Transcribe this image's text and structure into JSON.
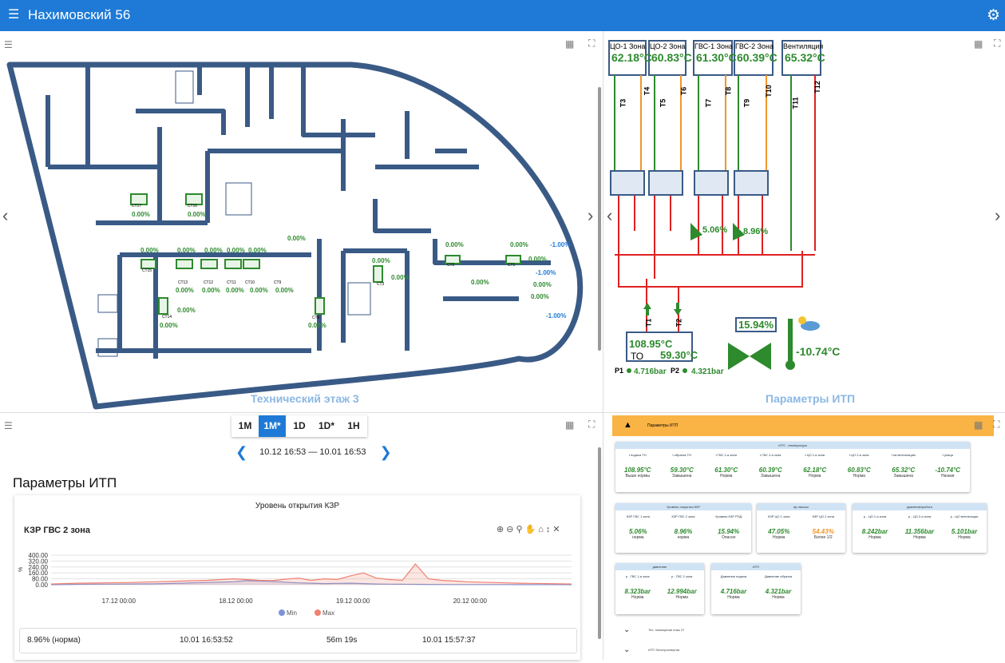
{
  "app": {
    "title": "Нахимовский 56"
  },
  "floor_panel": {
    "title": "Технический этаж 3",
    "devices": [
      {
        "name": "СТ17",
        "value": "0.00%"
      },
      {
        "name": "СТ16",
        "value": "0.00%"
      },
      {
        "name": "СТ15",
        "value": "0.00%"
      },
      {
        "name": "СТ13",
        "value": "0.00%"
      },
      {
        "name": "СТ12",
        "value": "0.00%"
      },
      {
        "name": "СТ11",
        "value": "0.00%"
      },
      {
        "name": "СТ10",
        "value": "0.00%"
      },
      {
        "name": "СТ9",
        "value": "0.00%"
      },
      {
        "name": "СТ14",
        "value": "0.00%"
      },
      {
        "name": "СТ9",
        "value": "0.00%"
      },
      {
        "name": "СТ3",
        "value": "0.00%"
      },
      {
        "name": "СТ2",
        "value": "0.00%"
      },
      {
        "name": "СТ1",
        "value": "0.00%"
      }
    ],
    "extra_values": [
      "0.00%",
      "0.00%",
      "0.00%",
      "0.00%",
      "0.00%",
      "0.00%",
      "0.00%",
      "0.00%",
      "0.00%",
      "0.00%",
      "0.00%",
      "0.00%",
      "-1.00%",
      "-1.00%",
      "-1.00%",
      "0.00%",
      "0.00%",
      "0.00%"
    ]
  },
  "itp_panel": {
    "title": "Параметры ИТП",
    "zones": [
      {
        "label": "ЦО-1 Зона",
        "value": "62.18°C"
      },
      {
        "label": "ЦО-2 Зона",
        "value": "60.83°C"
      },
      {
        "label": "ГВС-1 Зона",
        "value": "61.30°C"
      },
      {
        "label": "ГВС-2 Зона",
        "value": "60.39°C"
      },
      {
        "label": "Вентиляция",
        "value": "65.32°C"
      }
    ],
    "pipes": [
      "T3",
      "T4",
      "T5",
      "T6",
      "T7",
      "T8",
      "T9",
      "T10",
      "T11",
      "T12",
      "T1",
      "T2"
    ],
    "valve1": "5.06%",
    "valve2": "8.96%",
    "to_label": "ТО",
    "to_t1": "108.95°C",
    "to_t2": "59.30°C",
    "p1_label": "P1",
    "p1": "4.716bar",
    "p2_label": "P2",
    "p2": "4.321bar",
    "main_valve": "15.94%",
    "outdoor": "-10.74°C"
  },
  "history": {
    "periods": [
      "1M",
      "1M*",
      "1D",
      "1D*",
      "1H"
    ],
    "active_period": "1M*",
    "range": "10.12 16:53 — 10.01 16:53",
    "section_title": "Параметры ИТП",
    "card_title": "Уровень открытия КЗР",
    "chart_name": "КЗР ГВС 2 зона",
    "stat_value": "8.96% (норма)",
    "stat_time1": "10.01 16:53:52",
    "stat_duration": "56m 19s",
    "stat_time2": "10.01 15:57:37"
  },
  "chart_data": {
    "type": "line",
    "title": "КЗР ГВС 2 зона",
    "ylabel": "%",
    "ylim": [
      0,
      400
    ],
    "yticks": [
      "0.00",
      "80.00",
      "160.00",
      "240.00",
      "320.00",
      "400.00"
    ],
    "xticks": [
      "17.12 00:00",
      "18.12 00:00",
      "19.12 00:00",
      "20.12 00:00"
    ],
    "x": [
      0,
      2,
      4,
      6,
      8,
      10,
      12,
      14,
      15,
      16,
      17,
      18,
      19,
      20,
      21,
      22,
      23,
      24,
      25,
      26,
      27,
      28,
      29,
      30,
      31,
      32,
      33,
      34,
      35,
      36,
      37,
      38,
      39,
      40
    ],
    "series": [
      {
        "name": "Min",
        "color": "#7b93d6",
        "values": [
          0,
          5,
          8,
          10,
          12,
          20,
          30,
          40,
          55,
          50,
          45,
          35,
          25,
          20,
          15,
          18,
          20,
          15,
          10,
          8,
          6,
          5,
          4,
          3,
          2,
          2,
          2,
          2,
          2,
          1,
          1,
          1,
          1,
          0
        ]
      },
      {
        "name": "Max",
        "color": "#f08070",
        "values": [
          10,
          20,
          25,
          30,
          40,
          50,
          60,
          80,
          70,
          60,
          55,
          75,
          90,
          60,
          80,
          70,
          120,
          160,
          90,
          70,
          60,
          280,
          80,
          60,
          50,
          40,
          35,
          30,
          25,
          20,
          18,
          15,
          12,
          10
        ]
      }
    ]
  },
  "params": {
    "header": "Параметры ИТП",
    "temps_card": {
      "title": "ИТП - температура",
      "cells": [
        {
          "l": "t подача ТН",
          "v": "108.95°C",
          "s": "Выше нормы"
        },
        {
          "l": "t обратка ТН",
          "v": "59.30°C",
          "s": "Завышена"
        },
        {
          "l": "t ГВС 1-я зона",
          "v": "61.30°C",
          "s": "Норма"
        },
        {
          "l": "t ГВС 2-я зона",
          "v": "60.39°C",
          "s": "Завышена"
        },
        {
          "l": "t ЦО 1-я зона",
          "v": "62.18°C",
          "s": "Норма"
        },
        {
          "l": "t ЦО 2-я зона",
          "v": "60.83°C",
          "s": "Норма"
        },
        {
          "l": "t на вентиляцию",
          "v": "65.32°C",
          "s": "Завышена"
        },
        {
          "l": "t улица",
          "v": "-10.74°C",
          "s": "Низкая"
        }
      ]
    },
    "kzr_card": {
      "title": "Уровень открытия КЗР",
      "cells": [
        {
          "l": "КЗР ГВС 1 зона",
          "v": "5.06%",
          "s": "норма"
        },
        {
          "l": "КЗР ГВС 2 зона",
          "v": "8.96%",
          "s": "норма"
        },
        {
          "l": "Уровень КЗР РПД",
          "v": "15.94%",
          "s": "Опасно"
        }
      ]
    },
    "pump_card": {
      "title": "пр-насосы",
      "cells": [
        {
          "l": "КЗР ЦО 1 зона",
          "v": "47.05%",
          "s": "Норма"
        },
        {
          "l": "КЗР ЦО 2 зона",
          "v": "54.43%",
          "s": "Более 1/2"
        }
      ]
    },
    "p1_card": {
      "title": "давление/работа",
      "cells": [
        {
          "l": "р - ЦО 1-я зона",
          "v": "8.242bar",
          "s": "Норма"
        },
        {
          "l": "р - ЦО 2-я зона",
          "v": "11.356bar",
          "s": "Норма"
        },
        {
          "l": "р - ЦО вентиляции",
          "v": "5.101bar",
          "s": "Норма"
        }
      ]
    },
    "p2_card": {
      "title": "давление",
      "cells": [
        {
          "l": "р - ГВС 1-я зона",
          "v": "8.323bar",
          "s": "Норма"
        },
        {
          "l": "р - ГВС 2 зона",
          "v": "12.994bar",
          "s": "Норма"
        }
      ]
    },
    "p3_card": {
      "title": "ИТП",
      "cells": [
        {
          "l": "Давление подача",
          "v": "4.716bar",
          "s": "Норма"
        },
        {
          "l": "Давление обратка",
          "v": "4.321bar",
          "s": "Норма"
        }
      ]
    },
    "collapsed": [
      "Тех. помещения этаж 27",
      "ИТП Электроэнергия"
    ]
  },
  "legend": {
    "min": "Min",
    "max": "Max"
  },
  "icons": [
    "menu-icon",
    "gear-icon",
    "list-icon",
    "widget-add-icon",
    "fullscreen-icon",
    "chevron-left-icon",
    "chevron-right-icon"
  ]
}
